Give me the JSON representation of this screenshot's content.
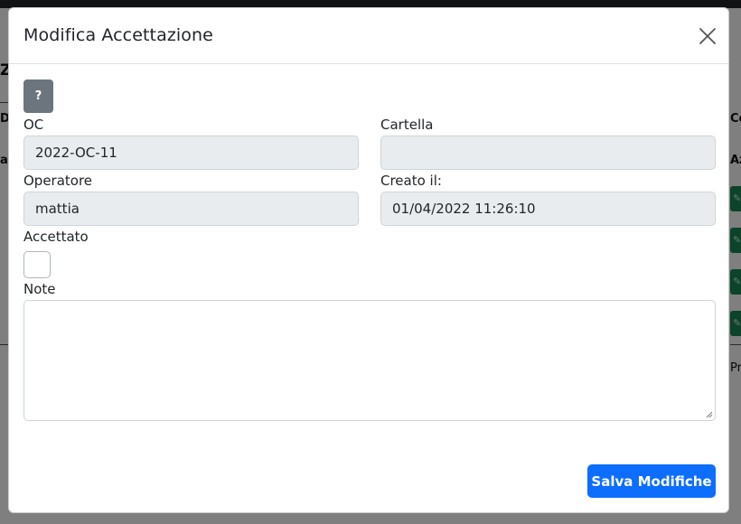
{
  "background": {
    "left_letter": "Z",
    "left_col1": "D",
    "left_col2": "ar",
    "right_col1": "Cc",
    "right_col2": "Az",
    "right_col3": "Pr"
  },
  "modal": {
    "title": "Modifica Accettazione",
    "help_label": "?",
    "fields": {
      "oc": {
        "label": "OC",
        "value": "2022-OC-11"
      },
      "cartella": {
        "label": "Cartella",
        "value": ""
      },
      "operatore": {
        "label": "Operatore",
        "value": "mattia"
      },
      "creato": {
        "label": "Creato il:",
        "value": "01/04/2022 11:26:10"
      },
      "accettato": {
        "label": "Accettato",
        "checked": false
      },
      "note": {
        "label": "Note",
        "value": ""
      }
    },
    "save_label": "Salva Modifiche"
  },
  "colors": {
    "primary": "#0d6efd",
    "secondary": "#6c757d",
    "success": "#198754",
    "readonly_bg": "#e9ecef"
  }
}
